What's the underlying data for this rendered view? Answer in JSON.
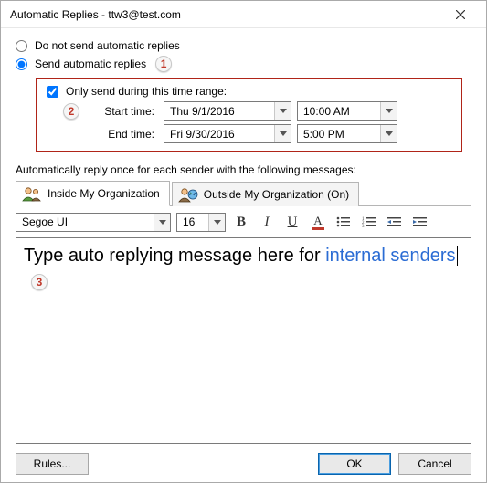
{
  "window": {
    "title": "Automatic Replies - ttw3@test.com"
  },
  "options": {
    "do_not_send_label": "Do not send automatic replies",
    "send_label": "Send automatic replies"
  },
  "callouts": {
    "one": "1",
    "two": "2",
    "three": "3"
  },
  "timerange": {
    "only_send_label": "Only send during this time range:",
    "start_label": "Start time:",
    "end_label": "End time:",
    "start_date": "Thu 9/1/2016",
    "start_time": "10:00 AM",
    "end_date": "Fri 9/30/2016",
    "end_time": "5:00 PM"
  },
  "section_label": "Automatically reply once for each sender with the following messages:",
  "tabs": {
    "inside": "Inside My Organization",
    "outside": "Outside My Organization (On)"
  },
  "toolbar": {
    "font": "Segoe UI",
    "size": "16",
    "bold": "B",
    "italic": "I",
    "underline": "U",
    "fontcolor": "A"
  },
  "editor": {
    "part1": "Type auto replying message here for ",
    "part2": "internal senders"
  },
  "buttons": {
    "rules": "Rules...",
    "ok": "OK",
    "cancel": "Cancel"
  }
}
